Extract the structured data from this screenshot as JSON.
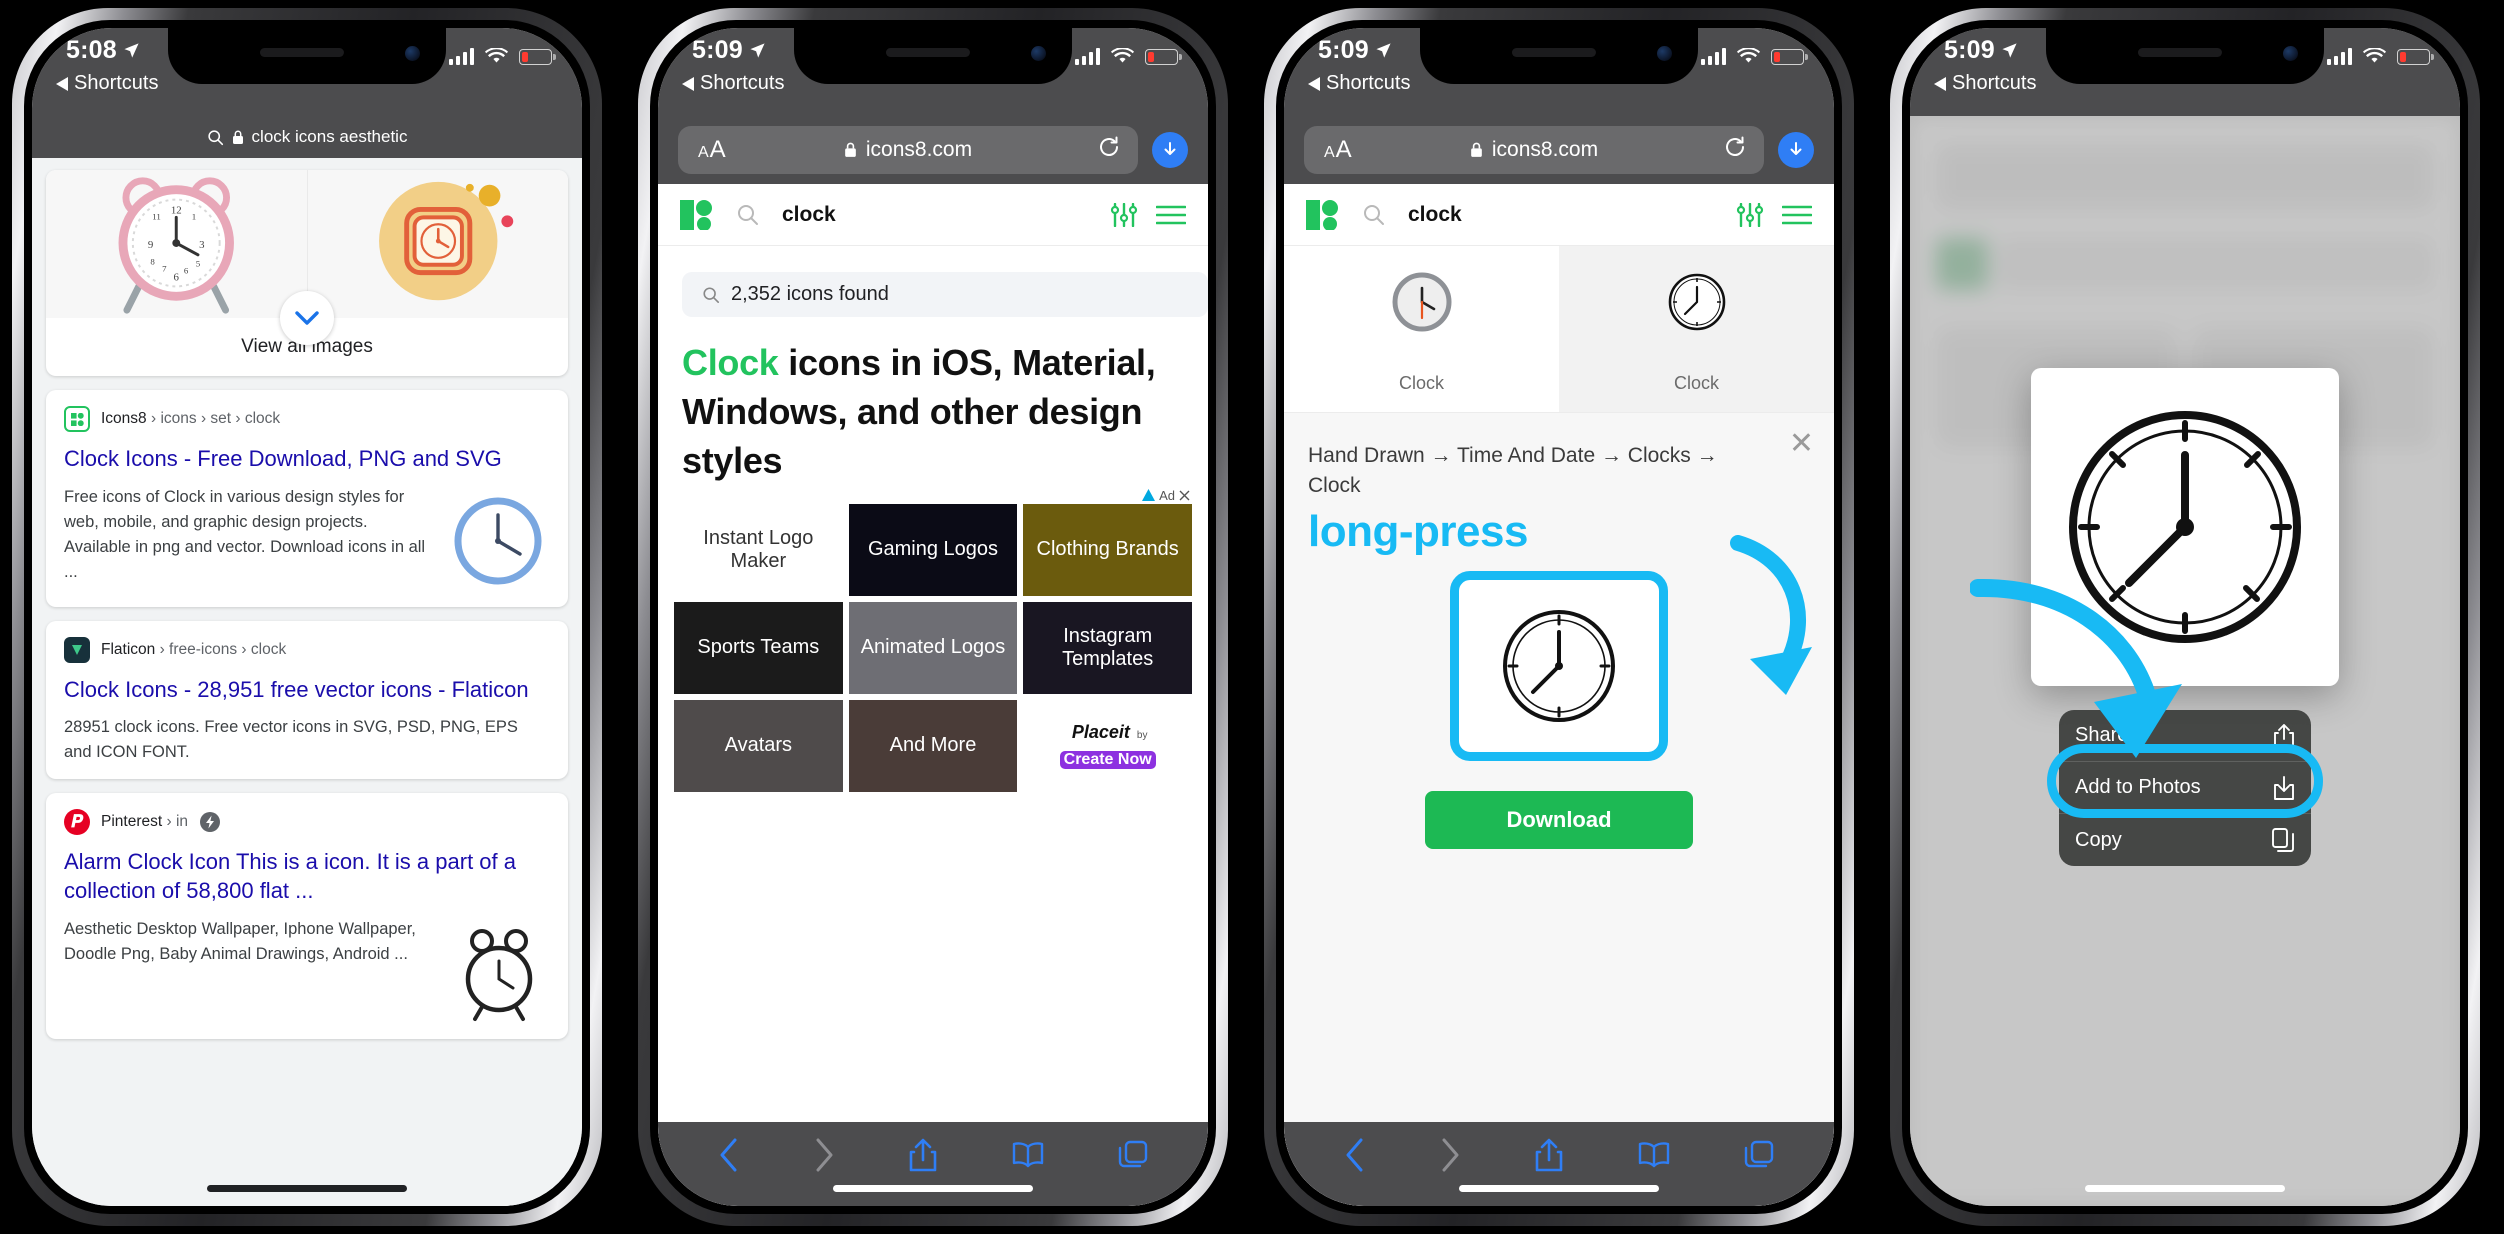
{
  "phones": [
    {
      "id": "phone-1-google-results",
      "status": {
        "time": "5:08",
        "back_label": "Shortcuts"
      },
      "search_query": "clock icons aesthetic",
      "images_card": {
        "view_all_label": "View all images"
      },
      "results": [
        {
          "site": "Icons8",
          "breadcrumb": "› icons › set › clock",
          "title": "Clock Icons - Free Download, PNG and SVG",
          "desc": "Free icons of Clock in various design styles for web, mobile, and graphic design projects. Available in png and vector. Download icons in all ...",
          "favicon_color": "#22c35e",
          "has_thumb": true
        },
        {
          "site": "Flaticon",
          "breadcrumb": "› free-icons › clock",
          "title": "Clock Icons - 28,951 free vector icons - Flaticon",
          "desc": "28951 clock icons. Free vector icons in SVG, PSD, PNG, EPS and ICON FONT.",
          "favicon_color": "#17313b",
          "has_thumb": false
        },
        {
          "site": "Pinterest",
          "breadcrumb": "› in",
          "amp": true,
          "title": "Alarm Clock Icon This is a icon. It is a part of a collection of 58,800 flat ...",
          "desc": "Aesthetic Desktop Wallpaper, Iphone Wallpaper, Doodle Png, Baby Animal Drawings, Android ...",
          "favicon_color": "#e60023",
          "has_thumb": true
        }
      ]
    },
    {
      "id": "phone-2-icons8-search",
      "status": {
        "time": "5:09",
        "back_label": "Shortcuts"
      },
      "url": "icons8.com",
      "aa_label_small": "A",
      "aa_label_large": "A",
      "site_query": "clock",
      "found_pill": "2,352 icons found",
      "hero_green": "Clock",
      "hero_rest": " icons in iOS, Material, Windows, and other design styles",
      "ad": {
        "label": "Ad",
        "cells": [
          {
            "label": "Instant Logo Maker",
            "bg": "#ffffff",
            "style": "white"
          },
          {
            "label": "Gaming Logos",
            "bg": "#0b0b16"
          },
          {
            "label": "Clothing Brands",
            "bg": "#6b5b0d"
          },
          {
            "label": "Sports Teams",
            "bg": "#1b1b1b"
          },
          {
            "label": "Animated Logos",
            "bg": "#6e6e74"
          },
          {
            "label": "Instagram Templates",
            "bg": "#191622"
          },
          {
            "label": "Avatars",
            "bg": "#4f4b4b"
          },
          {
            "label": "And More",
            "bg": "#4a3c38"
          }
        ],
        "brand": "Placeit",
        "brand_by": "by",
        "cta": "Create Now"
      }
    },
    {
      "id": "phone-3-icon-detail",
      "status": {
        "time": "5:09",
        "back_label": "Shortcuts"
      },
      "url": "icons8.com",
      "site_query": "clock",
      "icon_results": [
        {
          "caption": "Clock",
          "selected": false,
          "style": "ios"
        },
        {
          "caption": "Clock",
          "selected": true,
          "style": "hand-drawn"
        }
      ],
      "breadcrumb": "Hand Drawn → Time And Date → Clocks → Clock",
      "annotation": "long-press",
      "download_label": "Download",
      "close_label": "✕"
    },
    {
      "id": "phone-4-context-menu",
      "status": {
        "time": "5:09",
        "back_label": "Shortcuts"
      },
      "menu": [
        {
          "label": "Share...",
          "icon": "share-icon",
          "highlighted": false
        },
        {
          "label": "Add to Photos",
          "icon": "download-icon",
          "highlighted": true
        },
        {
          "label": "Copy",
          "icon": "copy-icon",
          "highlighted": false
        }
      ]
    }
  ],
  "colors": {
    "accent_cyan": "#18baf4",
    "icons8_green": "#22c35e",
    "download_green": "#1db954",
    "link_blue": "#1a0dab",
    "ios_blue": "#2f7ef5",
    "status_gray": "#4c4c4e"
  },
  "toolbar": {
    "back": "back-icon",
    "forward": "forward-icon",
    "share": "share-icon",
    "bookmarks": "book-icon",
    "tabs": "tabs-icon"
  }
}
